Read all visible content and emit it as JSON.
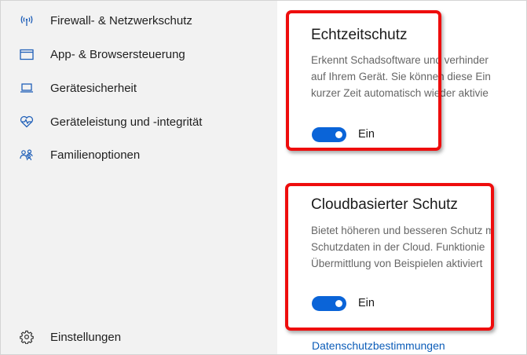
{
  "nav": {
    "items": [
      {
        "label": "Firewall- & Netzwerkschutz",
        "icon": "wifi-antenna-icon"
      },
      {
        "label": "App- & Browsersteuerung",
        "icon": "browser-window-icon"
      },
      {
        "label": "Gerätesicherheit",
        "icon": "laptop-icon"
      },
      {
        "label": "Geräteleistung und -integrität",
        "icon": "heart-pulse-icon"
      },
      {
        "label": "Familienoptionen",
        "icon": "family-icon"
      }
    ],
    "settings_label": "Einstellungen",
    "settings_icon": "gear-icon"
  },
  "realtime": {
    "title": "Echtzeitschutz",
    "desc_lines": [
      "Erkennt Schadsoftware und verhinder",
      "auf Ihrem Gerät. Sie können diese Ein",
      "kurzer Zeit automatisch wieder aktivie"
    ],
    "toggle_state": "Ein"
  },
  "cloud": {
    "title": "Cloudbasierter Schutz",
    "desc_lines": [
      "Bietet höheren und besseren Schutz m",
      "Schutzdaten in der Cloud. Funktionie",
      "Übermittlung von Beispielen aktiviert"
    ],
    "toggle_state": "Ein"
  },
  "privacy_link": "Datenschutzbestimmungen",
  "colors": {
    "accent": "#0a64d8",
    "highlight": "#ee0d0d",
    "sidebar_bg": "#f2f2f2",
    "link": "#0b5cb8"
  }
}
